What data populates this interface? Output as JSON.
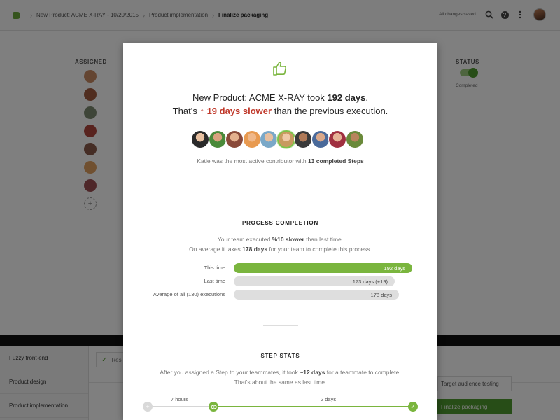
{
  "breadcrumb": {
    "items": [
      "New Product: ACME X-RAY - 10/20/2015",
      "Product implementation"
    ],
    "current": "Finalize packaging"
  },
  "header": {
    "saved_status": "All changes saved",
    "icons": [
      "search-icon",
      "help-icon",
      "more-vert-icon"
    ]
  },
  "background": {
    "assigned_heading": "ASSIGNED",
    "status_heading": "STATUS",
    "status_value": "Completed",
    "status_toggle_on": true,
    "add_symbol": "+",
    "sidebar_items": [
      "Fuzzy front-end",
      "Product design",
      "Product implementation"
    ],
    "result_snippet": "Res",
    "steps": [
      "Target audience testing",
      "Finalize packaging"
    ]
  },
  "modal": {
    "headline_prefix": "New Product: ACME X-RAY took ",
    "headline_days": "192 days",
    "headline_suffix": ".",
    "compare_prefix": "That’s ",
    "compare_arrow": "↑",
    "compare_slower": "19 days slower",
    "compare_suffix": " than the previous execution.",
    "contributors_count": 10,
    "top_contributor_index": 5,
    "contrib_text": "Katie was the most active contributor with ",
    "contrib_bold": "13 completed Steps",
    "process": {
      "title": "PROCESS COMPLETION",
      "line1_prefix": "Your team executed ",
      "line1_bold": "%10 slower",
      "line1_suffix": " than last time.",
      "line2_prefix": "On average it takes ",
      "line2_bold": "178 days",
      "line2_suffix": " for your team to complete this process.",
      "bars": [
        {
          "label": "This time",
          "value": "192 days",
          "days": 192,
          "highlight": true
        },
        {
          "label": "Last time",
          "value": "173 days (+19)",
          "days": 173,
          "highlight": false
        },
        {
          "label": "Average of all (130) executions",
          "value": "178 days",
          "days": 178,
          "highlight": false
        }
      ]
    },
    "steps": {
      "title": "STEP STATS",
      "line1_prefix": "After you assigned a Step to your teammates, it took ",
      "line1_bold": "~12 days",
      "line1_suffix": " for a teammate to complete.",
      "line2": "That’s about the same as last time.",
      "timeline_labels": [
        "7 hours",
        "2 days"
      ]
    }
  },
  "colors": {
    "accent_green": "#7ab53e",
    "dark_green": "#4f9a2e",
    "slower_red": "#c0392b"
  }
}
